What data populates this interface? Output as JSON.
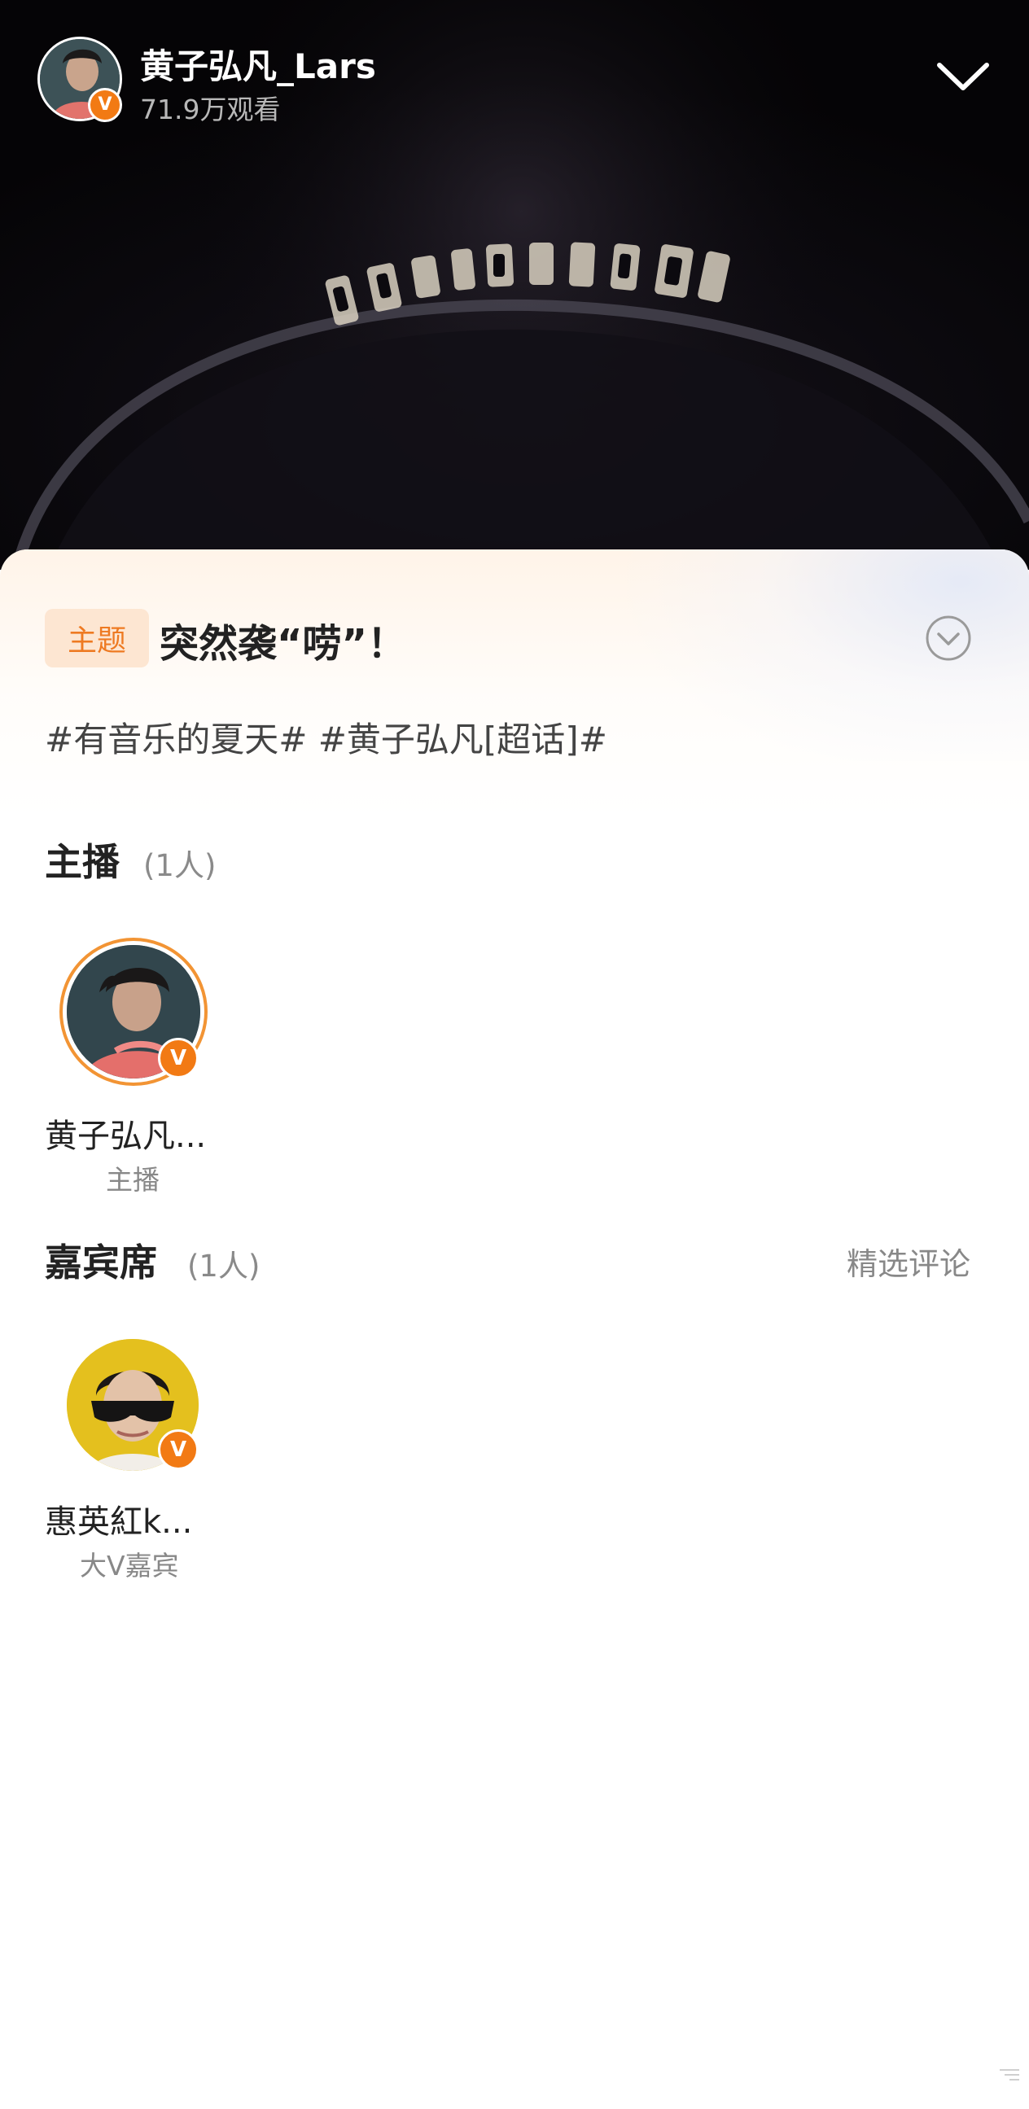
{
  "header": {
    "streamer_name": "黄子弘凡_Lars",
    "view_count": "71.9万观看",
    "verified_badge": "V",
    "collapse_icon": "chevron-down-icon"
  },
  "topic": {
    "tag": "主题",
    "title": "突然袭“唠”！",
    "expand_icon": "chevron-down-circle-icon",
    "hashtags": "#有音乐的夏天# #黄子弘凡[超话]#"
  },
  "hosts": {
    "title": "主播",
    "count": "(1人)",
    "members": [
      {
        "name": "黄子弘凡...",
        "role": "主播",
        "badge": "V"
      }
    ]
  },
  "guests": {
    "title": "嘉宾席",
    "count": "(1人)",
    "featured_link": "精选评论",
    "members": [
      {
        "name": "惠英紅k...",
        "role": "大V嘉宾",
        "badge": "V"
      }
    ]
  },
  "colors": {
    "accent": "#f27a14",
    "tag_bg": "#fde6d2",
    "tag_text": "#ee7a22",
    "video_bg": "#0c0a0f"
  }
}
